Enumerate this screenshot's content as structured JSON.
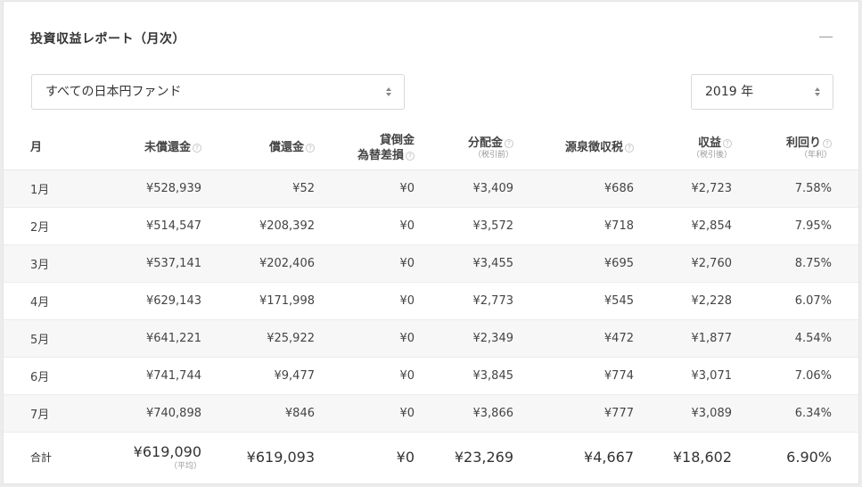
{
  "report": {
    "title": "投資収益レポート（月次）",
    "fund_select_value": "すべての日本円ファンド",
    "year_select_value": "2019 年"
  },
  "columns": [
    {
      "label": "月",
      "sub": "",
      "help": false
    },
    {
      "label": "未償還金",
      "sub": "",
      "help": true
    },
    {
      "label": "償還金",
      "sub": "",
      "help": true
    },
    {
      "label": "貸倒金",
      "label2": "為替差損",
      "sub": "",
      "help": true
    },
    {
      "label": "分配金",
      "sub": "（税引前）",
      "help": true
    },
    {
      "label": "源泉徴収税",
      "sub": "",
      "help": true
    },
    {
      "label": "収益",
      "sub": "（税引後）",
      "help": true
    },
    {
      "label": "利回り",
      "sub": "（年利）",
      "help": true
    }
  ],
  "rows": [
    [
      "1月",
      "¥528,939",
      "¥52",
      "¥0",
      "¥3,409",
      "¥686",
      "¥2,723",
      "7.58%"
    ],
    [
      "2月",
      "¥514,547",
      "¥208,392",
      "¥0",
      "¥3,572",
      "¥718",
      "¥2,854",
      "7.95%"
    ],
    [
      "3月",
      "¥537,141",
      "¥202,406",
      "¥0",
      "¥3,455",
      "¥695",
      "¥2,760",
      "8.75%"
    ],
    [
      "4月",
      "¥629,143",
      "¥171,998",
      "¥0",
      "¥2,773",
      "¥545",
      "¥2,228",
      "6.07%"
    ],
    [
      "5月",
      "¥641,221",
      "¥25,922",
      "¥0",
      "¥2,349",
      "¥472",
      "¥1,877",
      "4.54%"
    ],
    [
      "6月",
      "¥741,744",
      "¥9,477",
      "¥0",
      "¥3,845",
      "¥774",
      "¥3,071",
      "7.06%"
    ],
    [
      "7月",
      "¥740,898",
      "¥846",
      "¥0",
      "¥3,866",
      "¥777",
      "¥3,089",
      "6.34%"
    ]
  ],
  "total": {
    "label": "合計",
    "unredeemed": "¥619,090",
    "unredeemed_note": "（平均）",
    "redeemed": "¥619,093",
    "bad_debt_fx_loss": "¥0",
    "distribution": "¥23,269",
    "withholding_tax": "¥4,667",
    "profit": "¥18,602",
    "yield": "6.90%"
  },
  "help_icon_glyph": "?"
}
